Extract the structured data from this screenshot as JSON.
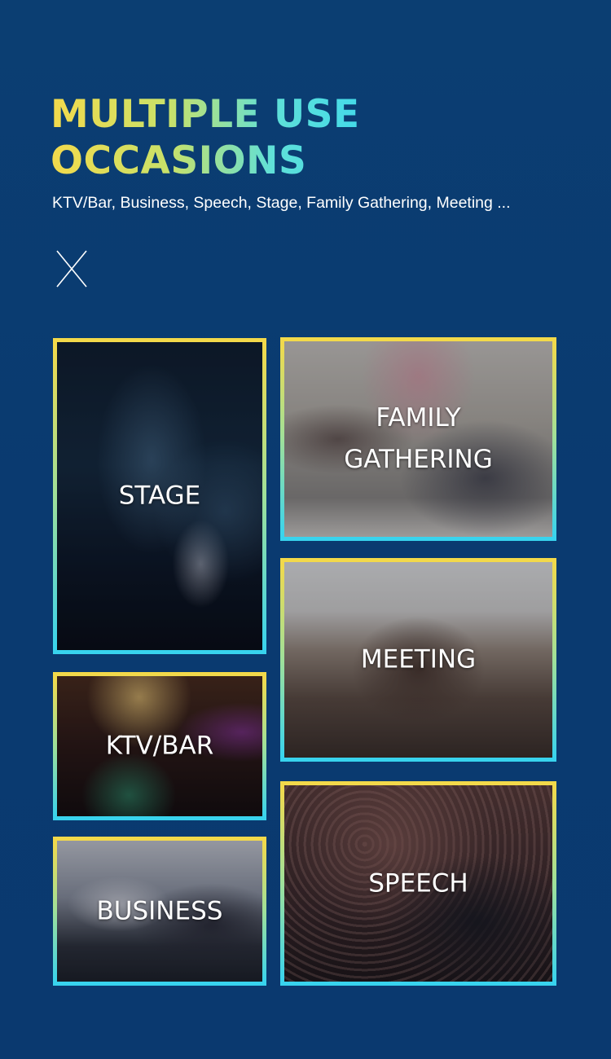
{
  "header": {
    "title_line1": "MULTIPLE USE",
    "title_line2": "OCCASIONS",
    "subtitle": "KTV/Bar, Business, Speech, Stage, Family Gathering, Meeting ...",
    "divider_icon": "x-mark-icon"
  },
  "cards": {
    "stage": {
      "label": "STAGE",
      "image": "stage-concert-photo"
    },
    "family": {
      "label": "FAMILY\nGATHERING",
      "image": "family-karaoke-photo"
    },
    "meeting": {
      "label": "MEETING",
      "image": "conference-room-photo"
    },
    "ktv": {
      "label": "KTV/BAR",
      "image": "ktv-bar-photo"
    },
    "business": {
      "label": "BUSINESS",
      "image": "business-team-photo"
    },
    "speech": {
      "label": "SPEECH",
      "image": "speech-audience-photo"
    }
  },
  "colors": {
    "background": "#0b3e72",
    "title_gradient_start": "#f3da4c",
    "title_gradient_end": "#3ad8ef",
    "frame_top": "#f3d94a",
    "frame_bottom": "#38d3ee",
    "text": "#ffffff"
  }
}
